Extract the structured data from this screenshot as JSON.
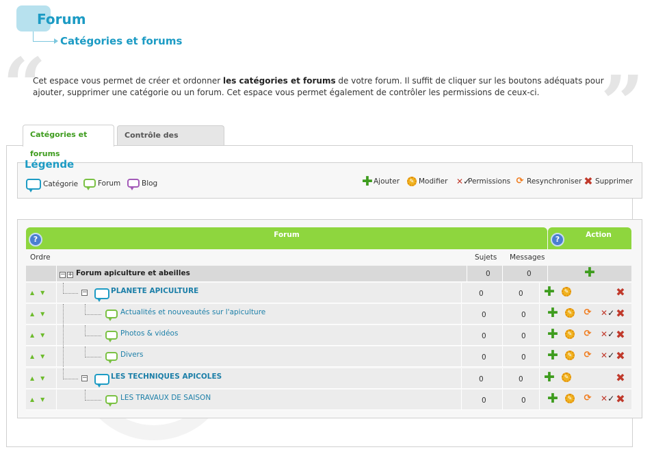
{
  "header": {
    "title": "Forum",
    "subtitle": "Catégories et forums"
  },
  "intro": {
    "part1": "Cet espace vous permet de créer et ordonner ",
    "bold": "les catégories et forums",
    "part2": " de votre forum. Il suffit de cliquer sur les boutons adéquats pour ajouter, supprimer une catégorie ou un forum. Cet espace vous permet également de contrôler les permissions de ceux-ci."
  },
  "tabs": [
    {
      "label": "Catégories et forums",
      "active": true
    },
    {
      "label": "Contrôle des Permissions",
      "active": false
    }
  ],
  "legend": {
    "title": "Légende",
    "types": [
      {
        "label": "Catégorie",
        "icon": "category-icon"
      },
      {
        "label": "Forum",
        "icon": "forum-icon"
      },
      {
        "label": "Blog",
        "icon": "blog-icon"
      }
    ],
    "actions": [
      {
        "label": "Ajouter",
        "icon": "add-icon"
      },
      {
        "label": "Modifier",
        "icon": "edit-icon"
      },
      {
        "label": "Permissions",
        "icon": "permissions-icon"
      },
      {
        "label": "Resynchroniser",
        "icon": "resync-icon"
      },
      {
        "label": "Supprimer",
        "icon": "delete-icon"
      }
    ]
  },
  "table": {
    "header_forum": "Forum",
    "header_action": "Action",
    "help_symbol": "?",
    "col_order": "Ordre",
    "col_topics": "Sujets",
    "col_messages": "Messages",
    "root": {
      "name": "Forum apiculture et abeilles",
      "topics": "0",
      "messages": "0"
    },
    "rows": [
      {
        "type": "category",
        "name": "PLANETE APICULTURE",
        "topics": "0",
        "messages": "0"
      },
      {
        "type": "forum",
        "name": "Actualités et nouveautés sur l'apiculture",
        "topics": "0",
        "messages": "0"
      },
      {
        "type": "forum",
        "name": "Photos & vidéos",
        "topics": "0",
        "messages": "0"
      },
      {
        "type": "forum",
        "name": "Divers",
        "topics": "0",
        "messages": "0"
      },
      {
        "type": "category",
        "name": "LES TECHNIQUES APICOLES",
        "topics": "0",
        "messages": "0"
      },
      {
        "type": "forum",
        "name": "LES TRAVAUX DE SAISON",
        "topics": "0",
        "messages": "0"
      }
    ]
  },
  "colors": {
    "accent_blue": "#1c9bc4",
    "header_green": "#8ed63e",
    "tab_green": "#3e9c1e"
  }
}
